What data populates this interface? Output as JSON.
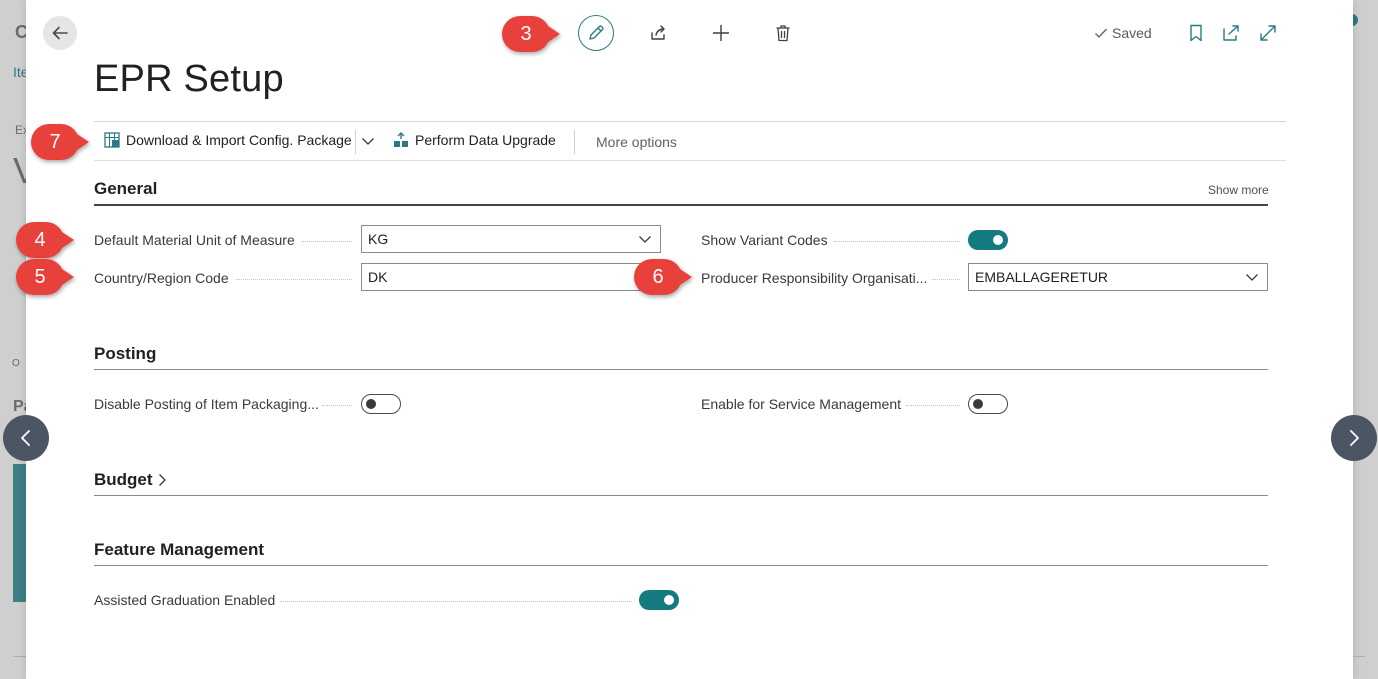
{
  "background": {
    "fragments": [
      "C",
      "Ite",
      "Ex",
      "V",
      "O",
      "Pa"
    ]
  },
  "header": {
    "saved_label": "Saved",
    "title": "EPR Setup"
  },
  "actions": {
    "download_import": "Download & Import Config. Package",
    "perform_upgrade": "Perform Data Upgrade",
    "more_options": "More options"
  },
  "sections": {
    "general": {
      "title": "General",
      "show_more": "Show more",
      "default_uom_label": "Default Material Unit of Measure",
      "default_uom_value": "KG",
      "country_label": "Country/Region Code",
      "country_value": "DK",
      "show_variant_label": "Show Variant Codes",
      "show_variant_on": true,
      "pro_label": "Producer Responsibility Organisati...",
      "pro_value": "EMBALLAGERETUR"
    },
    "posting": {
      "title": "Posting",
      "disable_posting_label": "Disable Posting of Item Packaging...",
      "disable_posting_on": false,
      "service_mgmt_label": "Enable for Service Management",
      "service_mgmt_on": false
    },
    "budget": {
      "title": "Budget"
    },
    "feature_management": {
      "title": "Feature Management",
      "assisted_grad_label": "Assisted Graduation Enabled",
      "assisted_grad_on": true
    }
  },
  "callouts": [
    "3",
    "4",
    "5",
    "6",
    "7"
  ],
  "colors": {
    "accent": "#137a7f",
    "callout": "#e8403a"
  }
}
